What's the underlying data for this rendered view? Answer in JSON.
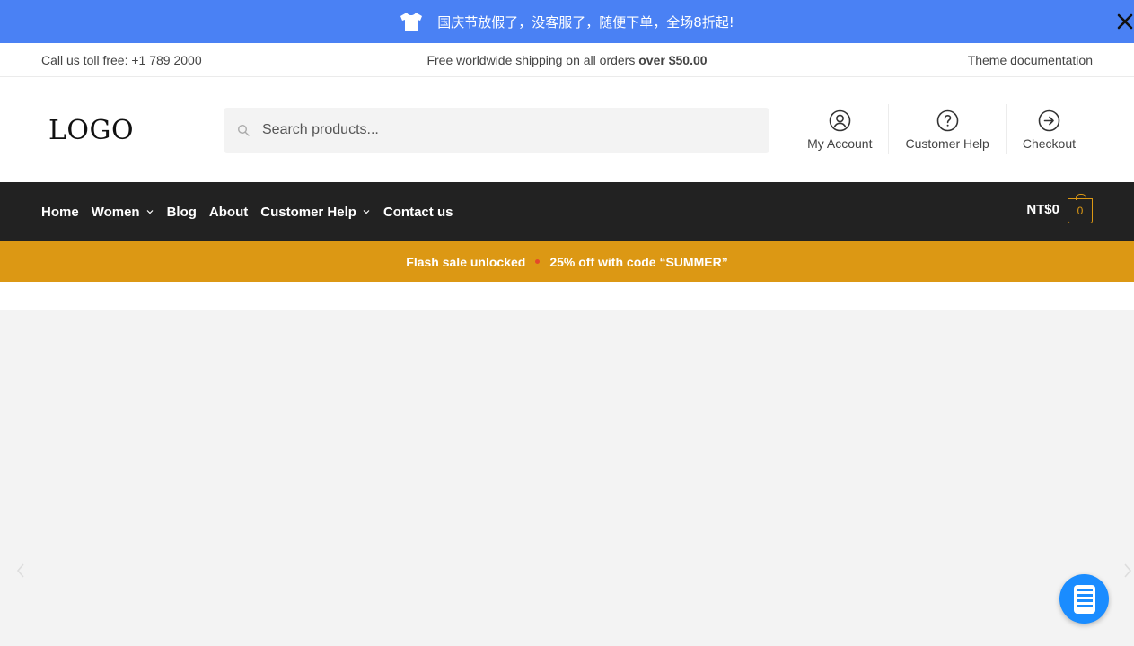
{
  "announcement": {
    "text": "国庆节放假了，没客服了，随便下单，全场8折起!",
    "icon": "tshirt-icon",
    "close_icon": "close-icon"
  },
  "topbar": {
    "phone_text": "Call us toll free: +1 789 2000",
    "shipping_text": "Free worldwide shipping on all orders ",
    "shipping_bold": "over $50.00",
    "docs_link": "Theme documentation"
  },
  "header": {
    "logo": "LOGO",
    "search_placeholder": "Search products...",
    "links": [
      {
        "label": "My Account",
        "icon": "user-circle-icon"
      },
      {
        "label": "Customer Help",
        "icon": "help-circle-icon"
      },
      {
        "label": "Checkout",
        "icon": "arrow-circle-icon"
      }
    ]
  },
  "nav": {
    "items": [
      {
        "label": "Home",
        "has_dropdown": false
      },
      {
        "label": "Women",
        "has_dropdown": true
      },
      {
        "label": "Blog",
        "has_dropdown": false
      },
      {
        "label": "About",
        "has_dropdown": false
      },
      {
        "label": "Customer Help",
        "has_dropdown": true
      },
      {
        "label": "Contact us",
        "has_dropdown": false
      }
    ],
    "cart_amount": "NT$0",
    "cart_count": "0"
  },
  "promo": {
    "left": "Flash sale unlocked",
    "right": "25% off with code “SUMMER”"
  },
  "colors": {
    "announcement_bg": "#4a81f4",
    "nav_bg": "#222222",
    "accent": "#dc9814",
    "hero_bg": "#f3f3f3",
    "fab_bg": "#1a8cff"
  }
}
